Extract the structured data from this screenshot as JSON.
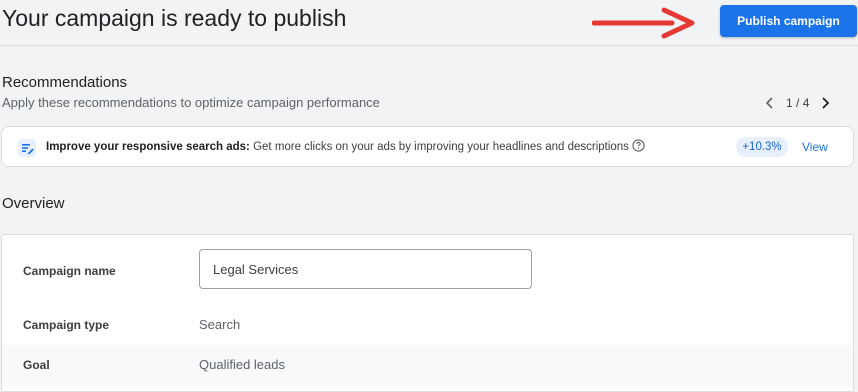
{
  "header": {
    "title": "Your campaign is ready to publish",
    "publish_label": "Publish campaign"
  },
  "recommendations": {
    "heading": "Recommendations",
    "subtitle": "Apply these recommendations to optimize campaign performance",
    "pager": {
      "current": "1",
      "separator": " / ",
      "total": "4"
    },
    "item": {
      "title": "Improve your responsive search ads:",
      "description": " Get more clicks on your ads by improving your headlines and descriptions",
      "uplift": "+10.3%",
      "action": "View"
    }
  },
  "overview": {
    "heading": "Overview",
    "rows": [
      {
        "label": "Campaign name",
        "value": "Legal Services"
      },
      {
        "label": "Campaign type",
        "value": "Search"
      },
      {
        "label": "Goal",
        "value": "Qualified leads"
      }
    ]
  },
  "colors": {
    "primary": "#1a73e8",
    "arrow": "#e53935",
    "chip_bg": "#e8f0fe",
    "page_bg": "#f1f3f4"
  },
  "icons": {
    "arrow": "red-arrow-icon",
    "prev": "chevron-left-icon",
    "next": "chevron-right-icon",
    "recommendation": "ad-edit-icon",
    "help": "help-icon"
  }
}
